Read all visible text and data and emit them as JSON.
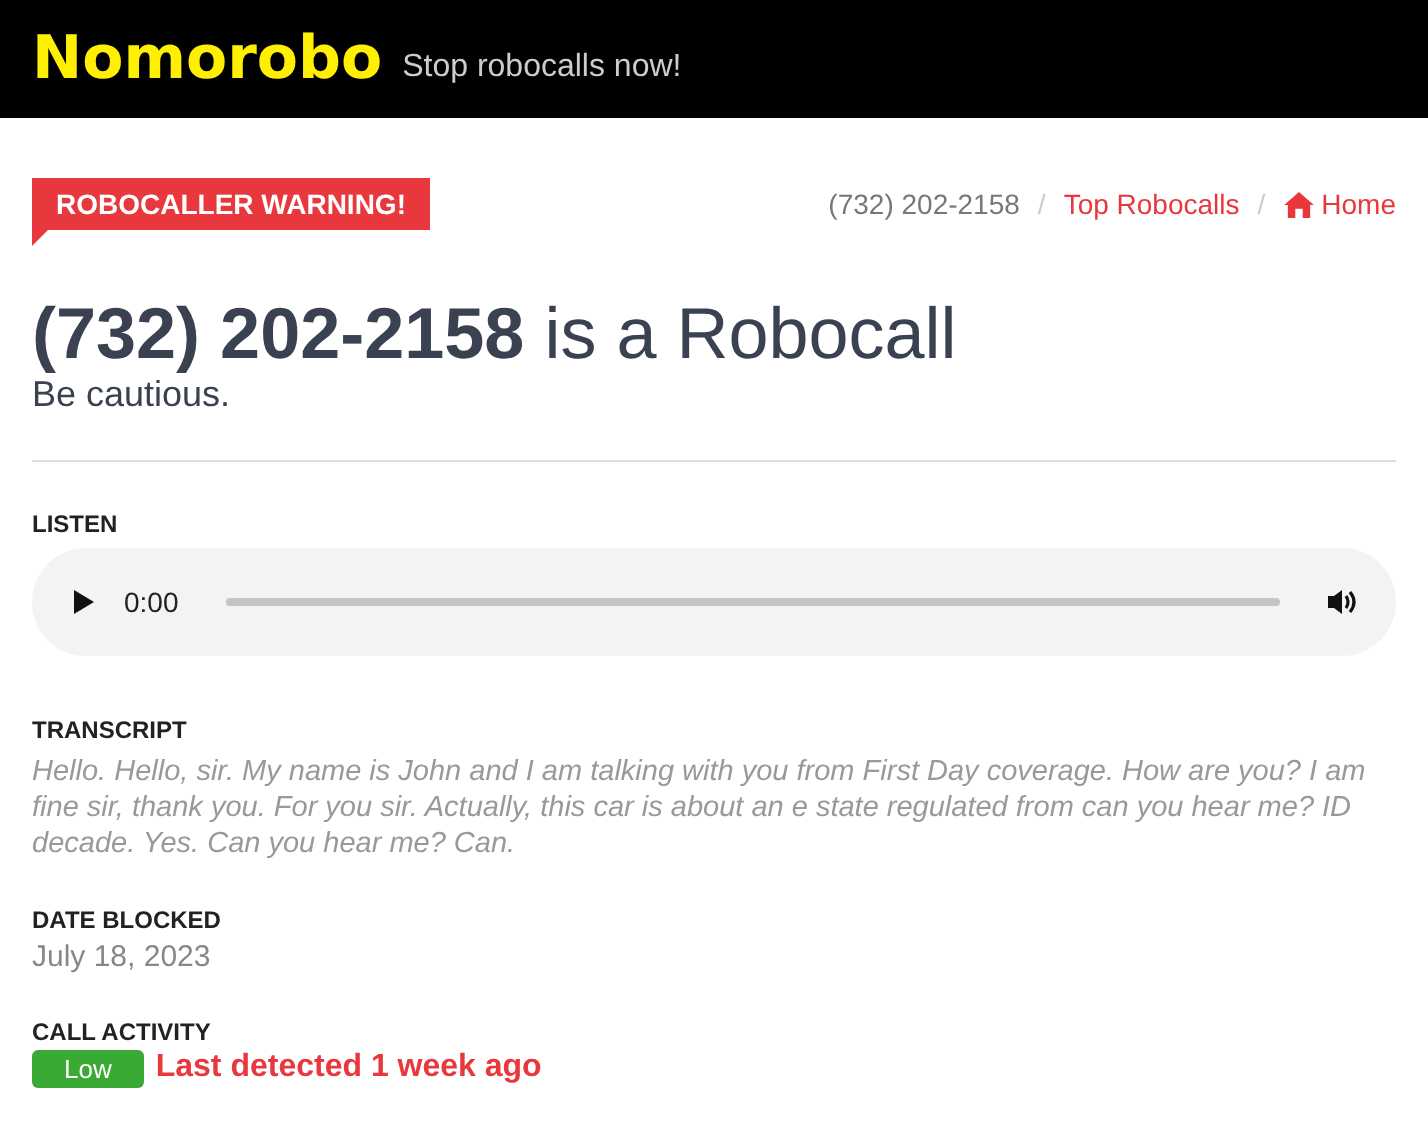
{
  "header": {
    "logo": "Nomorobo",
    "tagline": "Stop robocalls now!"
  },
  "warning_badge": "ROBOCALLER WARNING!",
  "breadcrumbs": [
    {
      "label": "(732) 202-2158",
      "kind": "text"
    },
    {
      "label": "/",
      "kind": "separator"
    },
    {
      "label": "Top Robocalls",
      "kind": "link"
    },
    {
      "label": "/",
      "kind": "separator"
    },
    {
      "label": "Home",
      "kind": "home_link"
    }
  ],
  "title": {
    "number": "(732) 202-2158",
    "rest": "is a Robocall"
  },
  "subtitle": "Be cautious.",
  "listen": {
    "label": "LISTEN",
    "time": "0:00"
  },
  "transcript": {
    "label": "TRANSCRIPT",
    "text": "Hello. Hello, sir. My name is John and I am talking with you from First Day coverage. How are you? I am fine sir, thank you. For you sir. Actually, this car is about an e state regulated from can you hear me? ID decade. Yes. Can you hear me? Can."
  },
  "date_blocked": {
    "label": "DATE BLOCKED",
    "value": "July 18, 2023"
  },
  "call_activity": {
    "label": "CALL ACTIVITY",
    "level_badge": "Low",
    "color": "#3aaa35",
    "detected": "Last detected 1 week ago"
  }
}
